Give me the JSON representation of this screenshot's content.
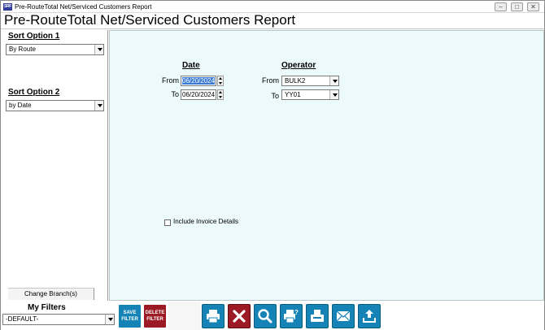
{
  "window": {
    "title": "Pre-RouteTotal Net/Serviced Customers Report",
    "app_icon_text": "SRF",
    "controls": [
      "minimize",
      "restore",
      "close"
    ]
  },
  "header": {
    "title": "Pre-RouteTotal Net/Serviced Customers Report"
  },
  "left_panel": {
    "sort1_label": "Sort Option 1",
    "sort1_value": "By Route",
    "sort2_label": "Sort Option 2",
    "sort2_value": "by Date",
    "change_branch_label": "Change Branch(s)"
  },
  "main": {
    "date_header": "Date",
    "operator_header": "Operator",
    "from_label": "From",
    "to_label": "To",
    "date_from": "06/20/2024",
    "date_to": "06/20/2024",
    "operator_from": "BULK2",
    "operator_to": "YY01",
    "include_invoice_details_label": "Include Invoice Details",
    "include_invoice_details_checked": false
  },
  "bottom": {
    "my_filters_label": "My Filters",
    "filter_value": "-DEFAULT-",
    "save_filter_line1": "SAVE",
    "save_filter_line2": "FILTER",
    "delete_filter_line1": "DELETE",
    "delete_filter_line2": "FILTER",
    "toolbar_icons": [
      "print-icon",
      "close-x-icon",
      "search-icon",
      "print-preview-icon",
      "fax-icon",
      "email-icon",
      "export-icon"
    ]
  },
  "colors": {
    "main_background": "#ecfafc",
    "button_blue": "#1683b6",
    "button_red": "#9c1a23",
    "selection": "#3a7bd5"
  }
}
